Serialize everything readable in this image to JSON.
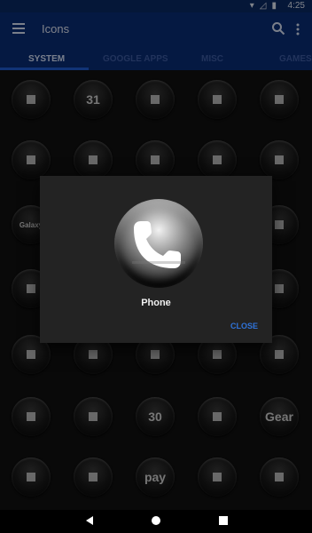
{
  "status": {
    "time": "4:25"
  },
  "appbar": {
    "title": "Icons"
  },
  "tabs": [
    {
      "label": "SYSTEM"
    },
    {
      "label": "GOOGLE APPS"
    },
    {
      "label": "MISC"
    },
    {
      "label": "GAMES"
    }
  ],
  "grid": {
    "rows": [
      [
        "calculator",
        "calendar",
        "camera",
        "mercedes",
        "contacts"
      ],
      [
        "download",
        "dropbox",
        "playstore",
        "excel",
        "facebook"
      ],
      [
        "galaxy",
        "",
        "",
        "",
        "notes"
      ],
      [
        "instagram",
        "",
        "",
        "",
        "mail"
      ],
      [
        "cloud",
        "onenote",
        "play",
        "pinterest",
        "phone"
      ],
      [
        "powerpoint",
        "dock",
        "calendar30",
        "mic",
        "gear"
      ],
      [
        "download2",
        "music",
        "samsungpay",
        "star",
        "sync"
      ]
    ],
    "texts": {
      "calendar": "31",
      "galaxy": "Galaxy",
      "calendar30": "30",
      "samsungpay": "pay",
      "gear": "Gear"
    }
  },
  "dialog": {
    "name": "Phone",
    "close_label": "CLOSE"
  },
  "colors": {
    "appbar": "#0a2f78",
    "accent": "#1f5ed8",
    "close": "#2f73d9"
  }
}
